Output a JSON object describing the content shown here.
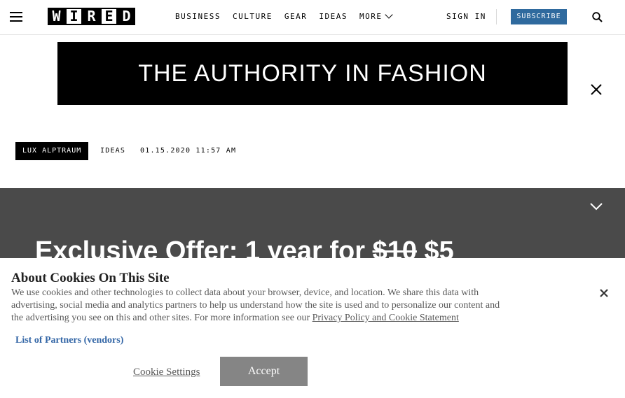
{
  "header": {
    "logo_letters": [
      "W",
      "I",
      "R",
      "E",
      "D"
    ],
    "nav": [
      {
        "label": "BUSINESS"
      },
      {
        "label": "CULTURE"
      },
      {
        "label": "GEAR"
      },
      {
        "label": "IDEAS"
      },
      {
        "label": "MORE"
      }
    ],
    "sign_in": "SIGN IN",
    "subscribe": "SUBSCRIBE",
    "icons": {
      "menu": "hamburger-icon",
      "search": "search-icon",
      "more": "chevron-down-icon"
    },
    "subscribe_color": "#2f6a9e"
  },
  "ad": {
    "text": "THE AUTHORITY IN FASHION",
    "close_icon": "close-icon"
  },
  "byline": {
    "author": "LUX ALPTRAUM",
    "category": "IDEAS",
    "date": "01.15.2020 11:57 AM"
  },
  "offer": {
    "title_prefix": "Exclusive Offer: 1 year for",
    "old_price": "$10",
    "new_price": "$5",
    "toggle_icon": "chevron-down-icon",
    "background": "#4a4a4a"
  },
  "cookie": {
    "title": "About Cookies On This Site",
    "body": "We use cookies and other technologies to collect data about your browser, device, and location. We share this data with advertising, social media and analytics partners to help us understand how the site is used and to personalize our content and the advertising you see on this and other sites. For more information see our",
    "policy_link": "Privacy Policy and Cookie Statement",
    "partners_link": "List of Partners (vendors)",
    "settings_label": "Cookie Settings",
    "accept_label": "Accept",
    "close_icon": "close-icon",
    "link_color": "#3366a6"
  }
}
